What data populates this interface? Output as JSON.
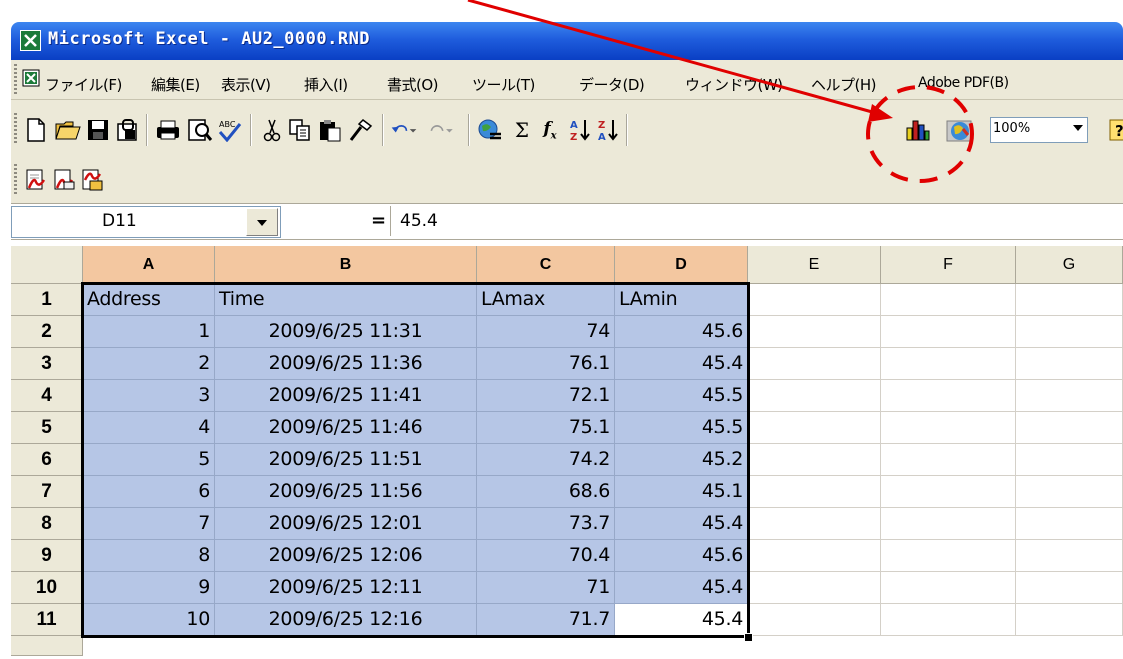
{
  "window": {
    "title": "Microsoft Excel - AU2_0000.RND",
    "title_icon": "excel-app-icon"
  },
  "menu": {
    "items": [
      {
        "label": "ファイル(F)"
      },
      {
        "label": "編集(E)"
      },
      {
        "label": "表示(V)"
      },
      {
        "label": "挿入(I)"
      },
      {
        "label": "書式(O)"
      },
      {
        "label": "ツール(T)"
      },
      {
        "label": "データ(D)"
      },
      {
        "label": "ウィンドウ(W)"
      },
      {
        "label": "ヘルプ(H)"
      },
      {
        "label": "Adobe PDF(B)"
      }
    ]
  },
  "toolbar": {
    "zoom_value": "100%",
    "icons": [
      "new-icon",
      "open-icon",
      "save-icon",
      "permission-icon",
      "print-icon",
      "print-preview-icon",
      "spelling-icon",
      "cut-icon",
      "copy-icon",
      "paste-icon",
      "format-painter-icon",
      "undo-icon",
      "redo-icon",
      "hyperlink-icon",
      "autosum-icon",
      "function-icon",
      "sort-ascending-icon",
      "sort-descending-icon",
      "chart-wizard-icon",
      "map-icon",
      "help-icon"
    ],
    "pdf_icons": [
      "convert-to-pdf-icon",
      "convert-and-email-icon",
      "convert-and-review-icon"
    ]
  },
  "formula_bar": {
    "name_box": "D11",
    "equals": "=",
    "value": "45.4"
  },
  "grid": {
    "columns": [
      "A",
      "B",
      "C",
      "D",
      "E",
      "F",
      "G"
    ],
    "rows": [
      "1",
      "2",
      "3",
      "4",
      "5",
      "6",
      "7",
      "8",
      "9",
      "10",
      "11"
    ],
    "header": {
      "a": "Address",
      "b": "Time",
      "c": "LAmax",
      "d": "LAmin"
    },
    "data": [
      {
        "address": "1",
        "time": "2009/6/25 11:31",
        "lamax": "74",
        "lamin": "45.6"
      },
      {
        "address": "2",
        "time": "2009/6/25 11:36",
        "lamax": "76.1",
        "lamin": "45.4"
      },
      {
        "address": "3",
        "time": "2009/6/25 11:41",
        "lamax": "72.1",
        "lamin": "45.5"
      },
      {
        "address": "4",
        "time": "2009/6/25 11:46",
        "lamax": "75.1",
        "lamin": "45.5"
      },
      {
        "address": "5",
        "time": "2009/6/25 11:51",
        "lamax": "74.2",
        "lamin": "45.2"
      },
      {
        "address": "6",
        "time": "2009/6/25 11:56",
        "lamax": "68.6",
        "lamin": "45.1"
      },
      {
        "address": "7",
        "time": "2009/6/25 12:01",
        "lamax": "73.7",
        "lamin": "45.4"
      },
      {
        "address": "8",
        "time": "2009/6/25 12:06",
        "lamax": "70.4",
        "lamin": "45.6"
      },
      {
        "address": "9",
        "time": "2009/6/25 12:11",
        "lamax": "71",
        "lamin": "45.4"
      },
      {
        "address": "10",
        "time": "2009/6/25 12:16",
        "lamax": "71.7",
        "lamin": "45.4"
      }
    ]
  },
  "colors": {
    "title_bar": "#1f5ddd",
    "selection": "#b6c6e6",
    "annotation": "#e00000",
    "chrome": "#ece9d8"
  }
}
